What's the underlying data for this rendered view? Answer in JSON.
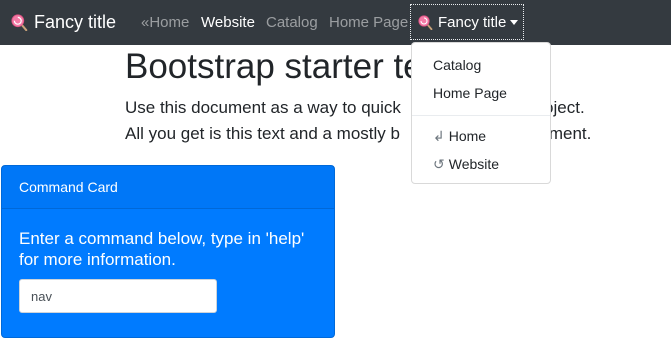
{
  "navbar": {
    "brand": {
      "icon": "lollipop-icon",
      "label": "Fancy title"
    },
    "links": [
      {
        "label": "«Home"
      },
      {
        "label": "Website"
      },
      {
        "label": "Catalog"
      },
      {
        "label": "Home Page"
      }
    ],
    "dropdown": {
      "icon": "lollipop-icon",
      "label": "Fancy title"
    }
  },
  "main": {
    "title": "Bootstrap starter te",
    "lead_line1": "Use this document as a way to quick",
    "lead_line1_tail": "project.",
    "lead_line2": "All you get is this text and a mostly b",
    "lead_line2_tail": "document."
  },
  "dropdown_menu": {
    "items": [
      {
        "label": "Catalog"
      },
      {
        "label": "Home Page"
      },
      {
        "glyph": "↲",
        "label": "Home"
      },
      {
        "glyph": "↺",
        "label": "Website"
      }
    ]
  },
  "command_card": {
    "header": "Command Card",
    "text": "Enter a command below, type in 'help' for more information.",
    "input_value": "nav"
  },
  "colors": {
    "navbar_bg": "#343a40",
    "card_bg": "#007bff"
  }
}
